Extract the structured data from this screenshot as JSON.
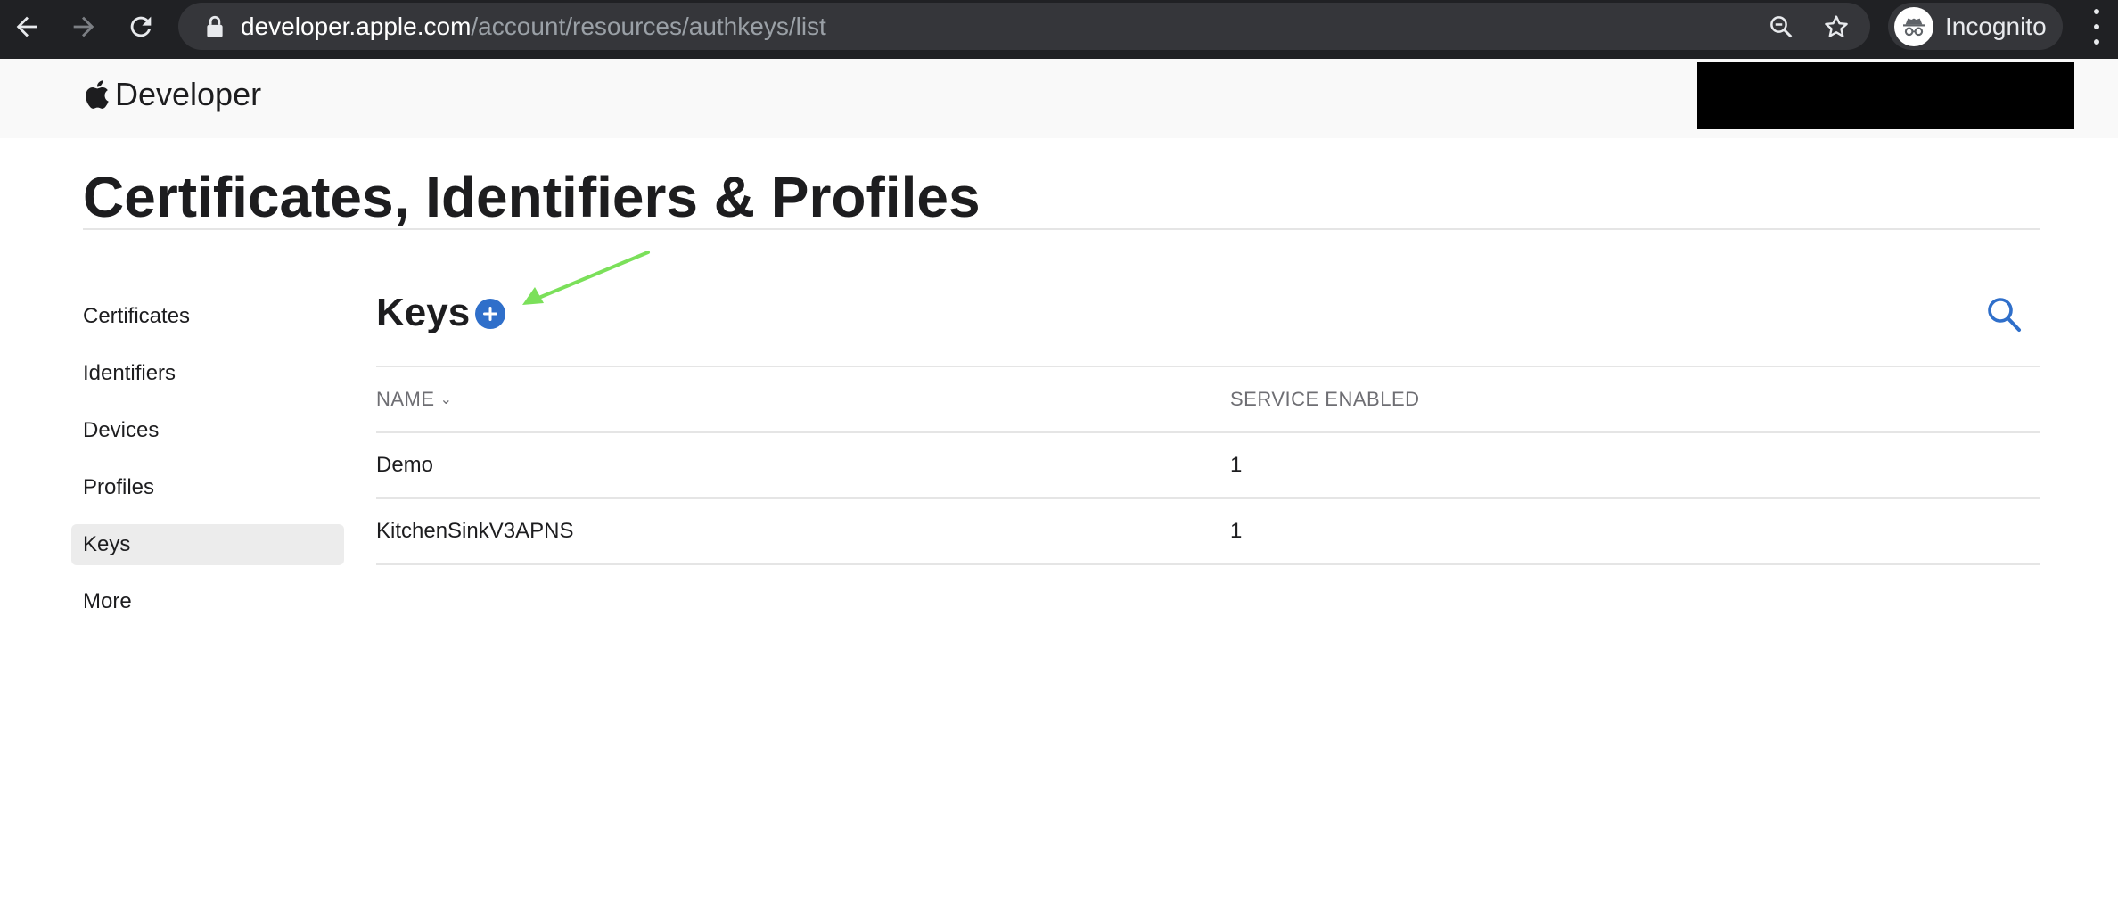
{
  "browser": {
    "url_host": "developer.apple.com",
    "url_path": "/account/resources/authkeys/list",
    "profile_label": "Incognito",
    "icons": [
      "back-icon",
      "forward-icon",
      "reload-icon",
      "lock-icon",
      "zoom-icon",
      "star-icon",
      "incognito-icon",
      "menu-icon"
    ]
  },
  "header": {
    "logo_text": "Developer"
  },
  "page": {
    "title": "Certificates, Identifiers & Profiles"
  },
  "sidebar": {
    "items": [
      {
        "label": "Certificates"
      },
      {
        "label": "Identifiers"
      },
      {
        "label": "Devices"
      },
      {
        "label": "Profiles"
      },
      {
        "label": "Keys",
        "active": true
      },
      {
        "label": "More"
      }
    ]
  },
  "main": {
    "heading": "Keys",
    "table": {
      "columns": [
        "NAME",
        "SERVICE ENABLED"
      ],
      "rows": [
        {
          "name": "Demo",
          "service_enabled": "1"
        },
        {
          "name": "KitchenSinkV3APNS",
          "service_enabled": "1"
        }
      ]
    }
  },
  "colors": {
    "accent": "#2f6fca",
    "annotation_arrow": "#7be05a",
    "chrome_bg": "#202124"
  }
}
